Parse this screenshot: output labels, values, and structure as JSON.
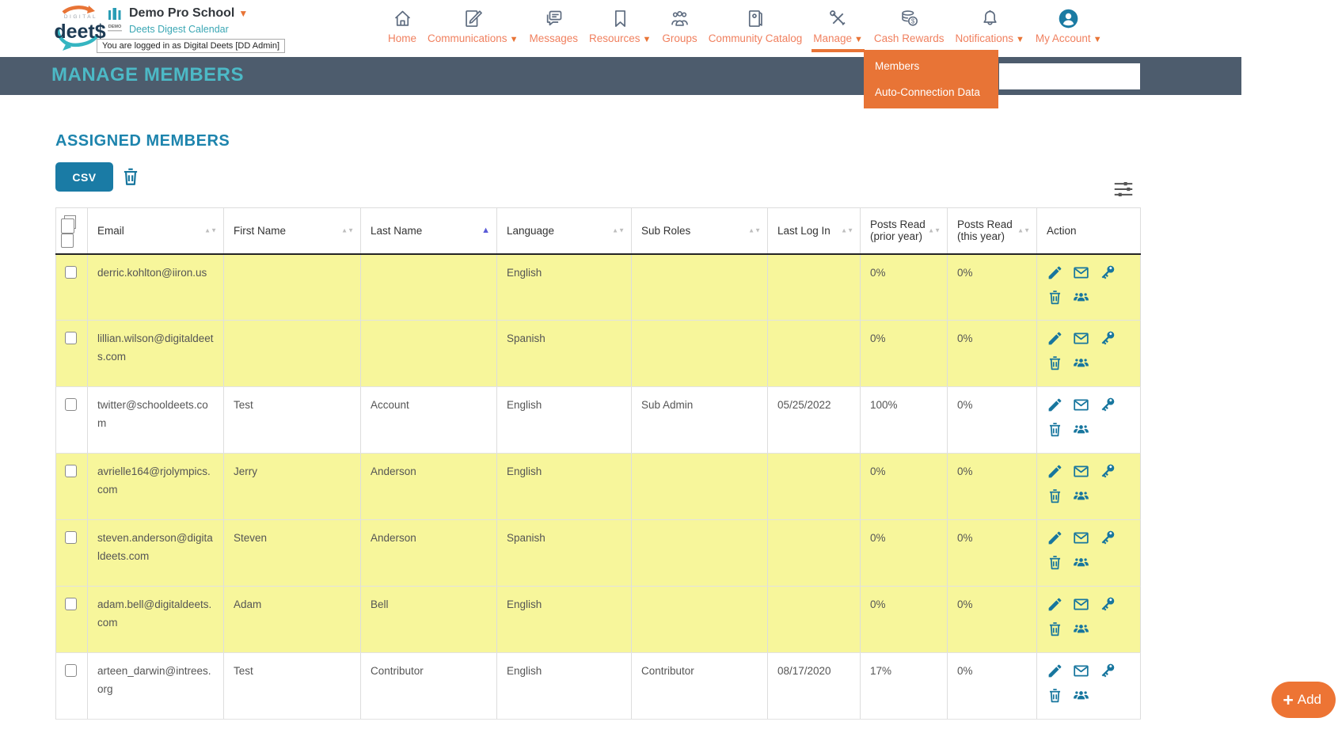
{
  "brand": {
    "logo_small_text": "DIGITAL",
    "logo_text": "deet$",
    "school_icon_label": "DEMO",
    "school_name": "Demo Pro School",
    "calendar_link": "Deets Digest Calendar",
    "logged_in_text": "You are logged in as Digital Deets [DD Admin]"
  },
  "nav": {
    "items": [
      {
        "label": "Home",
        "icon": "home-icon",
        "dropdown": false
      },
      {
        "label": "Communications",
        "icon": "communications-icon",
        "dropdown": true
      },
      {
        "label": "Messages",
        "icon": "messages-icon",
        "dropdown": false
      },
      {
        "label": "Resources",
        "icon": "resources-icon",
        "dropdown": true
      },
      {
        "label": "Groups",
        "icon": "groups-icon",
        "dropdown": false
      },
      {
        "label": "Community Catalog",
        "icon": "community-catalog-icon",
        "dropdown": false
      },
      {
        "label": "Manage",
        "icon": "manage-icon",
        "dropdown": true,
        "active": true
      },
      {
        "label": "Cash Rewards",
        "icon": "cash-rewards-icon",
        "dropdown": false
      },
      {
        "label": "Notifications",
        "icon": "notifications-icon",
        "dropdown": true
      },
      {
        "label": "My Account",
        "icon": "my-account-icon",
        "dropdown": true
      }
    ]
  },
  "manage_dropdown": {
    "items": [
      "Members",
      "Auto-Connection Data"
    ]
  },
  "page_header": {
    "title": "MANAGE MEMBERS",
    "search_value": ""
  },
  "content": {
    "section_title": "ASSIGNED MEMBERS",
    "csv_button": "CSV",
    "add_button": "Add"
  },
  "table": {
    "columns": [
      {
        "label": "",
        "key": "select"
      },
      {
        "label": "Email",
        "sort": "both"
      },
      {
        "label": "First Name",
        "sort": "both"
      },
      {
        "label": "Last Name",
        "sort": "asc"
      },
      {
        "label": "Language",
        "sort": "both"
      },
      {
        "label": "Sub Roles",
        "sort": "both"
      },
      {
        "label": "Last Log In",
        "sort": "both"
      },
      {
        "label": "Posts Read",
        "label2": "(prior year)",
        "sort": "both"
      },
      {
        "label": "Posts Read",
        "label2": "(this year)",
        "sort": "both"
      },
      {
        "label": "Action"
      }
    ],
    "action_icons": [
      "edit-icon",
      "email-icon",
      "key-icon",
      "delete-icon",
      "groups-icon"
    ],
    "rows": [
      {
        "email": "derric.kohlton@iiron.us",
        "first_name": "",
        "last_name": "",
        "language": "English",
        "sub_roles": "",
        "last_log_in": "",
        "posts_prior": "0%",
        "posts_this": "0%",
        "highlighted": true
      },
      {
        "email": "lillian.wilson@digitaldeets.com",
        "first_name": "",
        "last_name": "",
        "language": "Spanish",
        "sub_roles": "",
        "last_log_in": "",
        "posts_prior": "0%",
        "posts_this": "0%",
        "highlighted": true
      },
      {
        "email": "twitter@schooldeets.com",
        "first_name": "Test",
        "last_name": "Account",
        "language": "English",
        "sub_roles": "Sub Admin",
        "last_log_in": "05/25/2022",
        "posts_prior": "100%",
        "posts_this": "0%",
        "highlighted": false
      },
      {
        "email": "avrielle164@rjolympics.com",
        "first_name": "Jerry",
        "last_name": "Anderson",
        "language": "English",
        "sub_roles": "",
        "last_log_in": "",
        "posts_prior": "0%",
        "posts_this": "0%",
        "highlighted": true
      },
      {
        "email": "steven.anderson@digitaldeets.com",
        "first_name": "Steven",
        "last_name": "Anderson",
        "language": "Spanish",
        "sub_roles": "",
        "last_log_in": "",
        "posts_prior": "0%",
        "posts_this": "0%",
        "highlighted": true
      },
      {
        "email": "adam.bell@digitaldeets.com",
        "first_name": "Adam",
        "last_name": "Bell",
        "language": "English",
        "sub_roles": "",
        "last_log_in": "",
        "posts_prior": "0%",
        "posts_this": "0%",
        "highlighted": true
      },
      {
        "email": "arteen_darwin@intrees.org",
        "first_name": "Test",
        "last_name": "Contributor",
        "language": "English",
        "sub_roles": "Contributor",
        "last_log_in": "08/17/2020",
        "posts_prior": "17%",
        "posts_this": "0%",
        "highlighted": false
      }
    ]
  },
  "colors": {
    "accent_orange": "#e87436",
    "nav_label_orange": "#f0805f",
    "title_teal": "#4cb9c6",
    "section_blue": "#1d84ad",
    "button_teal": "#1a7ba5",
    "action_icon_teal": "#17769e",
    "row_highlight_yellow": "#f7f69b",
    "header_bar_slate": "#4d5c6d"
  }
}
